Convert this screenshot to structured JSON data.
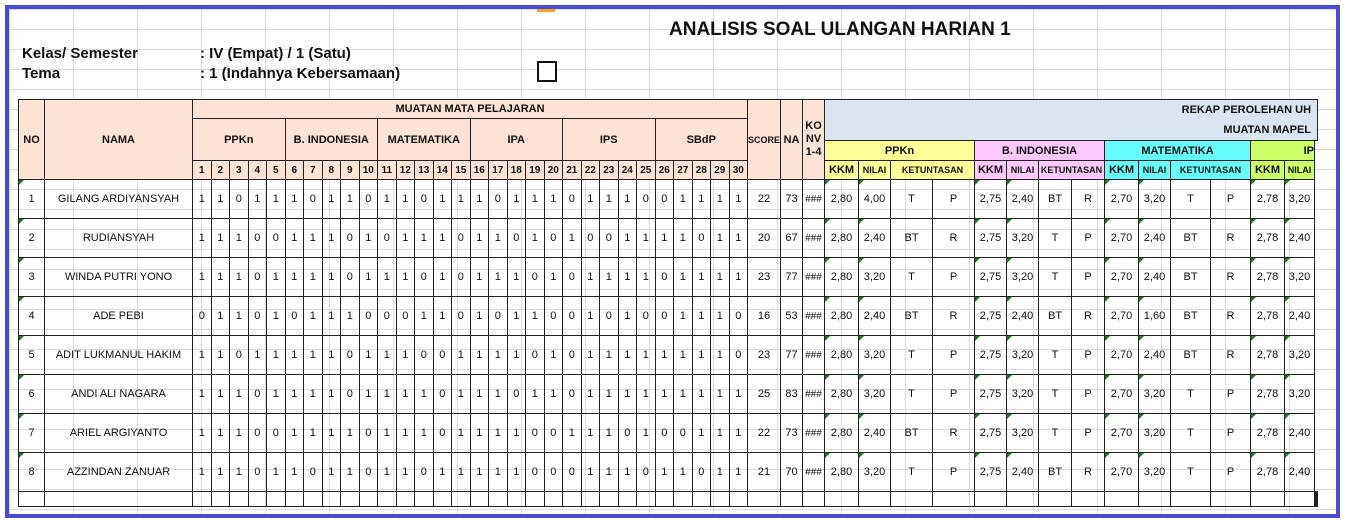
{
  "title": "ANALISIS SOAL ULANGAN HARIAN 1",
  "info": [
    {
      "label": "Kelas/ Semester",
      "value": ": IV (Empat) / 1 (Satu)"
    },
    {
      "label": "Tema",
      "value": ": 1 (Indahnya Kebersamaan)"
    }
  ],
  "headers": {
    "no": "NO",
    "nama": "NAMA",
    "muatan": "MUATAN MATA PELAJARAN",
    "subjects": [
      "PPKn",
      "B. INDONESIA",
      "MATEMATIKA",
      "IPA",
      "IPS",
      "SBdP"
    ],
    "score": "SCORE",
    "na": "NA",
    "konv": [
      "KO",
      "NV",
      "1-4"
    ],
    "rekap1": "REKAP PEROLEHAN UH",
    "rekap2": "MUATAN MAPEL",
    "rekap_subjects": [
      "PPKn",
      "B. INDONESIA",
      "MATEMATIKA",
      "IP"
    ],
    "rekap_cols": [
      "KKM",
      "NILAI",
      "KETUNTASAN"
    ],
    "rekap_partial": [
      "KKM",
      "NILAI"
    ]
  },
  "question_numbers": [
    "1",
    "2",
    "3",
    "4",
    "5",
    "6",
    "7",
    "8",
    "9",
    "10",
    "11",
    "12",
    "13",
    "14",
    "15",
    "16",
    "17",
    "18",
    "19",
    "20",
    "21",
    "22",
    "23",
    "24",
    "25",
    "26",
    "27",
    "28",
    "29",
    "30"
  ],
  "rows": [
    {
      "no": "1",
      "name": "GILANG ARDIYANSYAH",
      "red": false,
      "answers": [
        "1",
        "1",
        "0",
        "1",
        "1",
        "1",
        "0",
        "1",
        "1",
        "0",
        "1",
        "1",
        "0",
        "1",
        "1",
        "1",
        "0",
        "1",
        "1",
        "1",
        "0",
        "1",
        "1",
        "1",
        "0",
        "0",
        "1",
        "1",
        "1",
        "1"
      ],
      "score": "22",
      "na": "73",
      "konv": "###",
      "rekap": [
        [
          "2,80",
          "4,00",
          "T",
          "P"
        ],
        [
          "2,75",
          "2,40",
          "BT",
          "R"
        ],
        [
          "2,70",
          "3,20",
          "T",
          "P"
        ],
        [
          "2,78",
          "3,20"
        ]
      ]
    },
    {
      "no": "2",
      "name": "RUDIANSYAH",
      "red": false,
      "answers": [
        "1",
        "1",
        "1",
        "0",
        "0",
        "1",
        "1",
        "1",
        "0",
        "1",
        "0",
        "1",
        "1",
        "1",
        "0",
        "1",
        "1",
        "0",
        "1",
        "0",
        "1",
        "0",
        "0",
        "1",
        "1",
        "1",
        "1",
        "0",
        "1",
        "1"
      ],
      "score": "20",
      "na": "67",
      "konv": "###",
      "rekap": [
        [
          "2,80",
          "2,40",
          "BT",
          "R"
        ],
        [
          "2,75",
          "3,20",
          "T",
          "P"
        ],
        [
          "2,70",
          "2,40",
          "BT",
          "R"
        ],
        [
          "2,78",
          "2,40"
        ]
      ]
    },
    {
      "no": "3",
      "name": "WINDA PUTRI YONO",
      "red": true,
      "answers": [
        "1",
        "1",
        "1",
        "0",
        "1",
        "1",
        "1",
        "1",
        "0",
        "1",
        "1",
        "1",
        "0",
        "1",
        "0",
        "1",
        "1",
        "1",
        "0",
        "1",
        "0",
        "1",
        "1",
        "1",
        "1",
        "0",
        "1",
        "1",
        "1",
        "1"
      ],
      "score": "23",
      "na": "77",
      "konv": "###",
      "rekap": [
        [
          "2,80",
          "3,20",
          "T",
          "P"
        ],
        [
          "2,75",
          "3,20",
          "T",
          "P"
        ],
        [
          "2,70",
          "2,40",
          "BT",
          "R"
        ],
        [
          "2,78",
          "3,20"
        ]
      ]
    },
    {
      "no": "4",
      "name": "ADE PEBI",
      "red": false,
      "answers": [
        "0",
        "1",
        "1",
        "0",
        "1",
        "0",
        "1",
        "1",
        "1",
        "0",
        "0",
        "0",
        "1",
        "1",
        "0",
        "1",
        "0",
        "1",
        "1",
        "0",
        "0",
        "1",
        "0",
        "1",
        "0",
        "0",
        "1",
        "1",
        "1",
        "0"
      ],
      "score": "16",
      "na": "53",
      "konv": "###",
      "rekap": [
        [
          "2,80",
          "2,40",
          "BT",
          "R"
        ],
        [
          "2,75",
          "2,40",
          "BT",
          "R"
        ],
        [
          "2,70",
          "1,60",
          "BT",
          "R"
        ],
        [
          "2,78",
          "2,40"
        ]
      ]
    },
    {
      "no": "5",
      "name": "ADIT LUKMANUL HAKIM",
      "red": false,
      "answers": [
        "1",
        "1",
        "0",
        "1",
        "1",
        "1",
        "1",
        "1",
        "0",
        "1",
        "1",
        "1",
        "0",
        "0",
        "1",
        "1",
        "1",
        "1",
        "0",
        "1",
        "0",
        "1",
        "1",
        "1",
        "1",
        "1",
        "1",
        "1",
        "1",
        "0"
      ],
      "score": "23",
      "na": "77",
      "konv": "###",
      "rekap": [
        [
          "2,80",
          "3,20",
          "T",
          "P"
        ],
        [
          "2,75",
          "3,20",
          "T",
          "P"
        ],
        [
          "2,70",
          "2,40",
          "BT",
          "R"
        ],
        [
          "2,78",
          "3,20"
        ]
      ]
    },
    {
      "no": "6",
      "name": "ANDI ALI NAGARA",
      "red": false,
      "answers": [
        "1",
        "1",
        "1",
        "0",
        "1",
        "1",
        "1",
        "1",
        "0",
        "1",
        "1",
        "1",
        "1",
        "0",
        "1",
        "1",
        "1",
        "0",
        "1",
        "1",
        "0",
        "1",
        "1",
        "1",
        "1",
        "1",
        "1",
        "1",
        "1",
        "1"
      ],
      "score": "25",
      "na": "83",
      "konv": "###",
      "rekap": [
        [
          "2,80",
          "3,20",
          "T",
          "P"
        ],
        [
          "2,75",
          "3,20",
          "T",
          "P"
        ],
        [
          "2,70",
          "3,20",
          "T",
          "P"
        ],
        [
          "2,78",
          "3,20"
        ]
      ]
    },
    {
      "no": "7",
      "name": "ARIEL ARGIYANTO",
      "red": false,
      "answers": [
        "1",
        "1",
        "1",
        "0",
        "0",
        "1",
        "1",
        "1",
        "1",
        "0",
        "1",
        "1",
        "1",
        "0",
        "1",
        "1",
        "1",
        "1",
        "0",
        "0",
        "1",
        "1",
        "1",
        "0",
        "1",
        "0",
        "0",
        "1",
        "1",
        "1"
      ],
      "score": "22",
      "na": "73",
      "konv": "###",
      "rekap": [
        [
          "2,80",
          "2,40",
          "BT",
          "R"
        ],
        [
          "2,75",
          "3,20",
          "T",
          "P"
        ],
        [
          "2,70",
          "3,20",
          "T",
          "P"
        ],
        [
          "2,78",
          "2,40"
        ]
      ]
    },
    {
      "no": "8",
      "name": "AZZINDAN  ZANUAR",
      "red": false,
      "answers": [
        "1",
        "1",
        "1",
        "0",
        "1",
        "1",
        "0",
        "1",
        "1",
        "0",
        "1",
        "1",
        "0",
        "1",
        "1",
        "1",
        "1",
        "1",
        "0",
        "0",
        "0",
        "1",
        "1",
        "1",
        "0",
        "1",
        "1",
        "0",
        "1",
        "1"
      ],
      "score": "21",
      "na": "70",
      "konv": "###",
      "rekap": [
        [
          "2,80",
          "3,20",
          "T",
          "P"
        ],
        [
          "2,75",
          "2,40",
          "BT",
          "R"
        ],
        [
          "2,70",
          "3,20",
          "T",
          "P"
        ],
        [
          "2,78",
          "2,40"
        ]
      ]
    }
  ]
}
